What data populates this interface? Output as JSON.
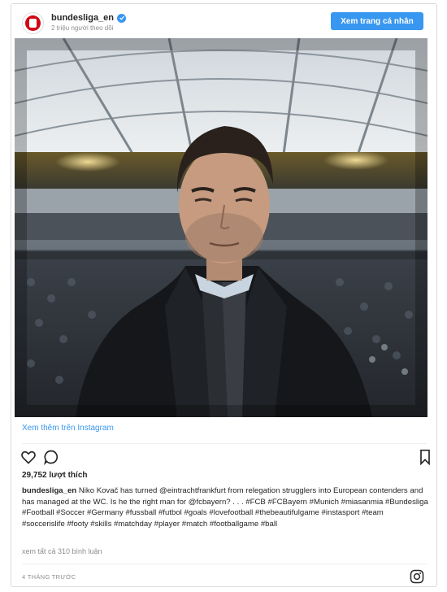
{
  "header": {
    "username": "bundesliga_en",
    "followers": "2 triệu người theo dõi",
    "follow_button": "Xem trang cá nhân"
  },
  "photo": {
    "alt_icon": "photo-niko-kovac"
  },
  "view_more": "Xem thêm trên Instagram",
  "actions": {
    "like_icon": "heart-icon",
    "comment_icon": "comment-icon",
    "save_icon": "bookmark-icon"
  },
  "likes": "29,752 lượt thích",
  "caption": {
    "username": "bundesliga_en",
    "text": " Niko Kovač has turned @eintrachtfrankfurt from relegation strugglers into European contenders and has managed at the WC. Is he the right man for @fcbayern? . . . #FCB #FCBayern #Munich #miasanmia #Bundesliga #Football #Soccer #Germany #fussball #futbol #goals #lovefootball #thebeautifulgame #instasport #team #soccerislife #footy #skills #matchday #player #match #footballgame #ball"
  },
  "comments_link": "xem tất cả 310 bình luận",
  "timestamp": "4 THÁNG TRƯỚC",
  "colors": {
    "accent": "#3897f0",
    "brand_red": "#d20515"
  }
}
